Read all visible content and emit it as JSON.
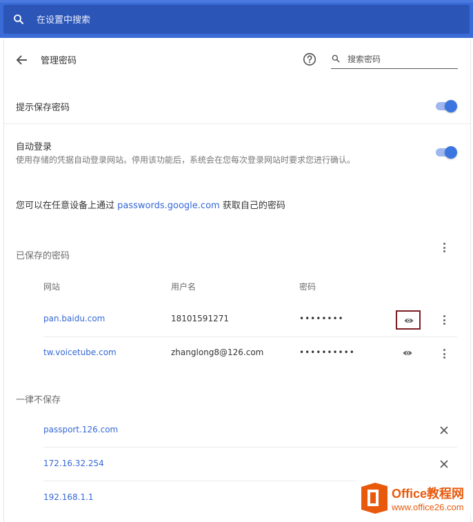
{
  "search": {
    "placeholder": "在设置中搜索",
    "icon": "search-icon"
  },
  "header": {
    "title": "管理密码",
    "back_icon": "arrow-back-icon",
    "help_icon": "help-icon",
    "password_search_placeholder": "搜索密码"
  },
  "settings": {
    "offer_save": {
      "label": "提示保存密码",
      "enabled": true
    },
    "auto_signin": {
      "label": "自动登录",
      "description": "使用存储的凭据自动登录网站。停用该功能后，系统会在您每次登录网站时要求您进行确认。",
      "enabled": true
    }
  },
  "sync": {
    "prefix": "您可以在任意设备上通过 ",
    "link": "passwords.google.com",
    "suffix": " 获取自己的密码"
  },
  "saved": {
    "title": "已保存的密码",
    "columns": [
      "网站",
      "用户名",
      "密码"
    ],
    "rows": [
      {
        "site": "pan.baidu.com",
        "username": "18101591271",
        "password": "••••••••"
      },
      {
        "site": "tw.voicetube.com",
        "username": "zhanglong8@126.com",
        "password": "••••••••••"
      }
    ]
  },
  "never_saved": {
    "title": "一律不保存",
    "sites": [
      "passport.126.com",
      "172.16.32.254",
      "192.168.1.1"
    ]
  },
  "watermark": {
    "brand": "Office教程网",
    "url": "www.office26.com"
  },
  "colors": {
    "accent": "#3367d6",
    "toolbar": "#3b6bd6",
    "highlight_border": "#7a1d22",
    "watermark": "#e8590c"
  }
}
